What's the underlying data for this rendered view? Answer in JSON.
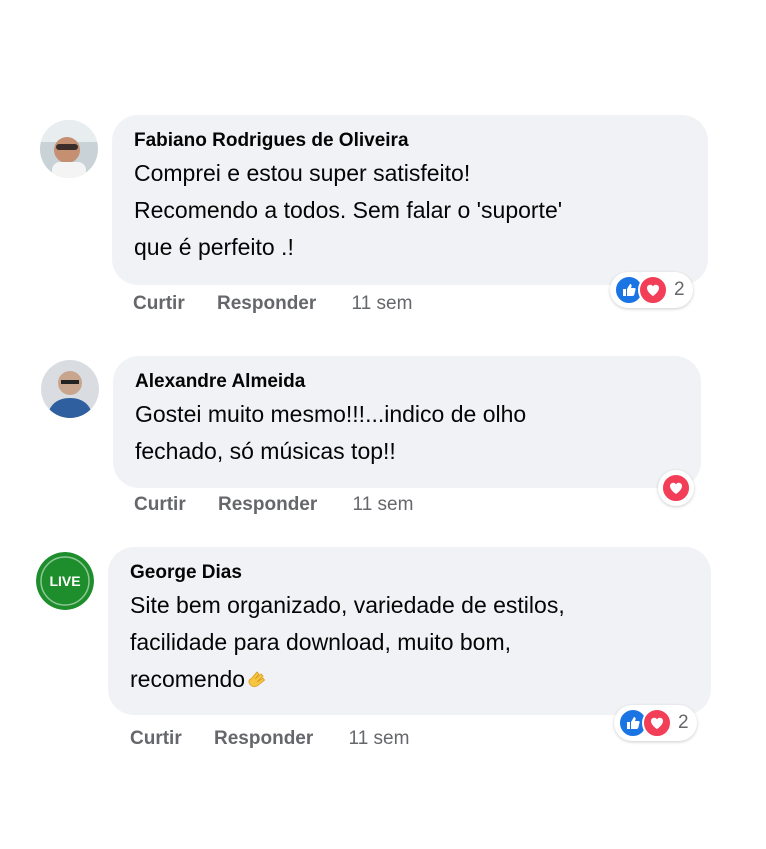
{
  "comments": [
    {
      "author": "Fabiano Rodrigues de Oliveira",
      "lines": [
        "Comprei e estou super satisfeito!",
        "Recomendo a todos. Sem falar o 'suporte'",
        "que é perfeito .!"
      ],
      "actions": {
        "like": "Curtir",
        "reply": "Responder",
        "time": "11 sem"
      },
      "reactions": {
        "types": [
          "like-icon",
          "love-icon"
        ],
        "count": "2"
      }
    },
    {
      "author": "Alexandre Almeida",
      "lines": [
        "Gostei muito mesmo!!!...indico de olho",
        "fechado, só músicas top!!"
      ],
      "actions": {
        "like": "Curtir",
        "reply": "Responder",
        "time": "11 sem"
      },
      "reactions": {
        "types": [
          "love-icon"
        ],
        "count": ""
      }
    },
    {
      "author": "George Dias",
      "lines": [
        "Site bem organizado, variedade de estilos,",
        "facilidade para download, muito bom,",
        "recomendo"
      ],
      "emoji": "clapping-hands-icon",
      "actions": {
        "like": "Curtir",
        "reply": "Responder",
        "time": "11 sem"
      },
      "reactions": {
        "types": [
          "like-icon",
          "love-icon"
        ],
        "count": "2"
      }
    }
  ],
  "colors": {
    "bubble": "#f0f2f5",
    "like": "#1b74e4",
    "love": "#f33e58",
    "meta": "#65676b"
  }
}
